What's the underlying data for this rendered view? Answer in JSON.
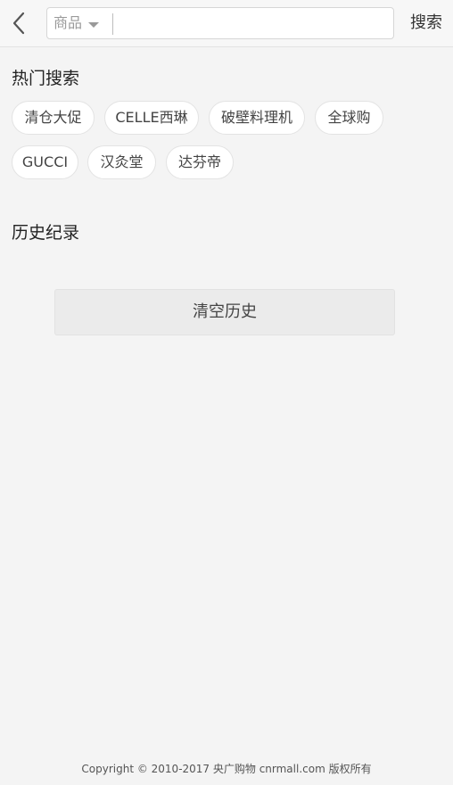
{
  "header": {
    "back_icon": "chevron-left-icon",
    "category_label": "商品",
    "category_caret_icon": "caret-down-icon",
    "search_value": "",
    "search_placeholder": "",
    "search_button_label": "搜索"
  },
  "hot_search": {
    "title": "热门搜索",
    "tags": [
      "清仓大促",
      "CELLE西琳",
      "破壁料理机",
      "全球购",
      "GUCCI",
      "汉灸堂",
      "达芬帝"
    ]
  },
  "history": {
    "title": "历史纪录",
    "clear_label": "清空历史"
  },
  "footer": {
    "copyright": "Copyright © 2010-2017 央广购物  cnrmall.com 版权所有"
  }
}
